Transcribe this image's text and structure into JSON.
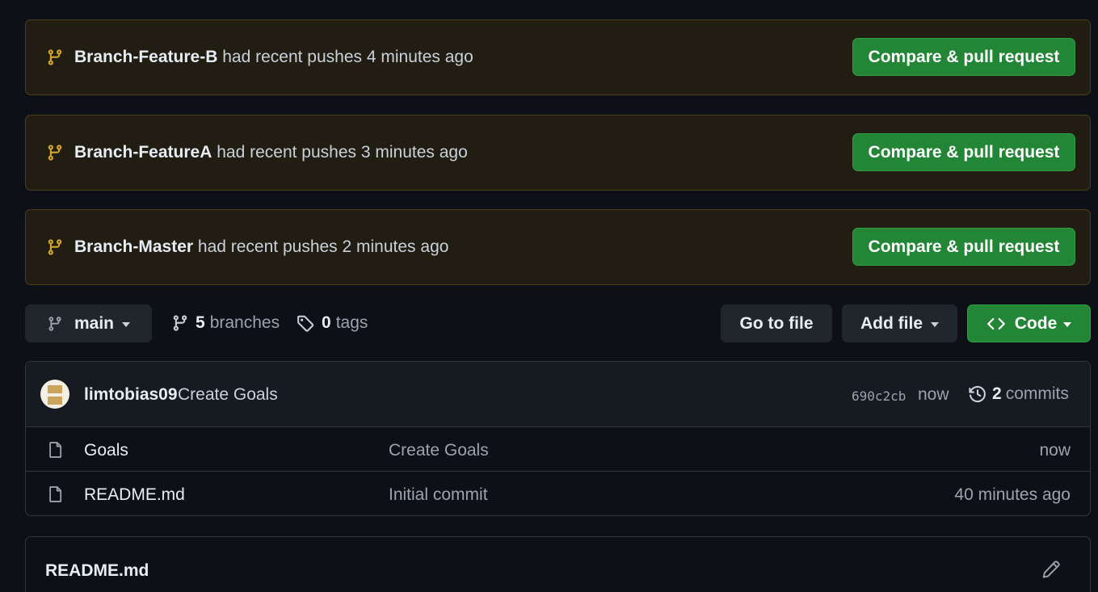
{
  "banners": [
    {
      "branch": "Branch-Feature-B",
      "text": "had recent pushes 4 minutes ago",
      "button": "Compare & pull request"
    },
    {
      "branch": "Branch-FeatureA",
      "text": "had recent pushes 3 minutes ago",
      "button": "Compare & pull request"
    },
    {
      "branch": "Branch-Master",
      "text": "had recent pushes 2 minutes ago",
      "button": "Compare & pull request"
    }
  ],
  "toolbar": {
    "branch_selector": "main",
    "branches_count": "5",
    "branches_label": "branches",
    "tags_count": "0",
    "tags_label": "tags",
    "go_to_file": "Go to file",
    "add_file": "Add file",
    "code": "Code"
  },
  "latest_commit": {
    "author": "limtobias09",
    "message": "Create Goals",
    "sha": "690c2cb",
    "time": "now",
    "commits_count": "2",
    "commits_label": "commits"
  },
  "files": [
    {
      "name": "Goals",
      "message": "Create Goals",
      "time": "now"
    },
    {
      "name": "README.md",
      "message": "Initial commit",
      "time": "40 minutes ago"
    }
  ],
  "readme": {
    "title": "README.md"
  },
  "colors": {
    "background": "#0d1117",
    "banner_bg": "#211d13",
    "banner_border": "#4b3d16",
    "branch_icon": "#d4a72c",
    "primary_button": "#238636"
  },
  "icons": [
    "git-branch-icon",
    "tag-icon",
    "code-icon",
    "history-icon",
    "file-icon",
    "pencil-icon",
    "caret-down-icon"
  ]
}
